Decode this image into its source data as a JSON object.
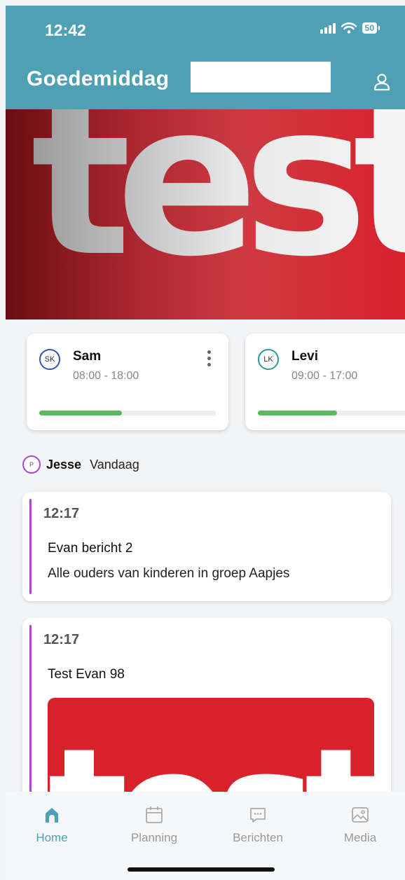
{
  "status_bar": {
    "time": "12:42",
    "battery": "50"
  },
  "header": {
    "greeting": "Goedemiddag"
  },
  "banner": {
    "text": "test"
  },
  "children": [
    {
      "initials": "SK",
      "name": "Sam",
      "hours": "08:00 - 18:00",
      "progress": 0.47,
      "ring_color": "#3f51b5"
    },
    {
      "initials": "LK",
      "name": "Levi",
      "hours": "09:00 - 17:00",
      "progress": 0.45,
      "ring_color": "#2a9d8f"
    }
  ],
  "feed": {
    "author_initial": "P",
    "author": "Jesse",
    "when": "Vandaag",
    "messages": [
      {
        "time": "12:17",
        "title": "Evan bericht 2",
        "body": "Alle ouders van kinderen in groep Aapjes"
      },
      {
        "time": "12:17",
        "title": "Test Evan 98",
        "image_text": "test"
      }
    ]
  },
  "nav": [
    {
      "label": "Home",
      "icon": "home-icon",
      "active": true
    },
    {
      "label": "Planning",
      "icon": "calendar-icon",
      "active": false
    },
    {
      "label": "Berichten",
      "icon": "chat-icon",
      "active": false
    },
    {
      "label": "Media",
      "icon": "image-icon",
      "active": false
    }
  ],
  "colors": {
    "primary": "#4ea1b5",
    "accent": "#a64cc9",
    "progress": "#5cb85c"
  }
}
